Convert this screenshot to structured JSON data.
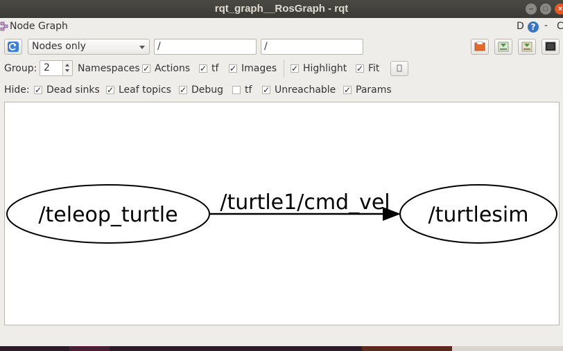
{
  "window": {
    "title": "rqt_graph__RosGraph - rqt"
  },
  "header": {
    "plugin_title": "Node Graph",
    "d_label": "D",
    "help_icon": "?",
    "dash": "-",
    "c_label": "C"
  },
  "toolbar": {
    "mode_value": "Nodes only",
    "node_filter_value": "/",
    "topic_filter_value": "/"
  },
  "group_row": {
    "group_label": "Group:",
    "group_value": "2",
    "namespaces_label": "Namespaces",
    "namespaces_checked": true,
    "actions_label": "Actions",
    "actions_checked": true,
    "tf_label": "tf",
    "tf_checked": true,
    "images_label": "Images",
    "images_checked": true,
    "highlight_label": "Highlight",
    "highlight_checked": true,
    "fit_label": "Fit",
    "fit_checked": true
  },
  "hide_row": {
    "hide_label": "Hide:",
    "dead_sinks_label": "Dead sinks",
    "dead_sinks_checked": true,
    "leaf_topics_label": "Leaf topics",
    "leaf_topics_checked": true,
    "debug_label": "Debug",
    "debug_checked": true,
    "tf_label": "tf",
    "tf_checked": false,
    "unreachable_label": "Unreachable",
    "unreachable_checked": true,
    "params_label": "Params",
    "params_checked": true
  },
  "graph": {
    "source_node": "/teleop_turtle",
    "target_node": "/turtlesim",
    "edge_label": "/turtle1/cmd_vel"
  },
  "colors": {
    "titlebar": "#3c3b37",
    "window_bg": "#efedea",
    "close_button": "#e95420",
    "help_blue": "#3b73c4"
  }
}
